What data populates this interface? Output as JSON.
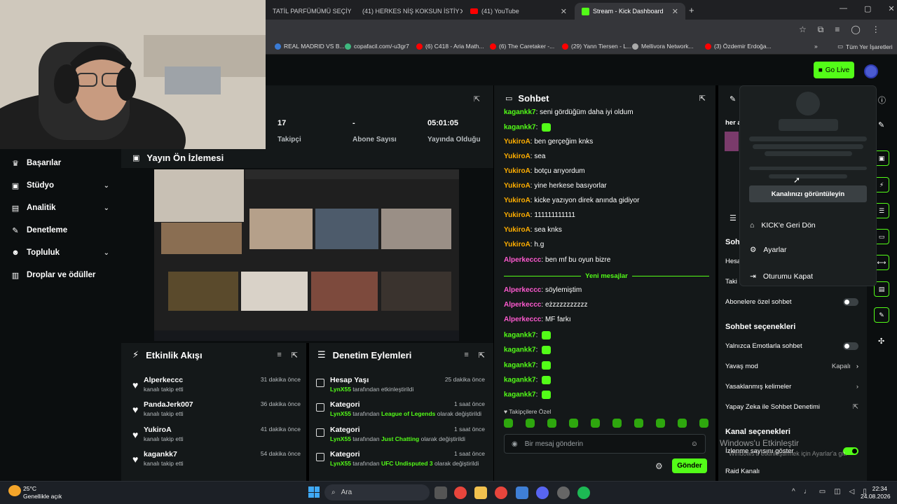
{
  "browser": {
    "tabs": [
      {
        "label": "TATİL PARFÜMÜMÜ SEÇİYO",
        "icon": "youtube-icon"
      },
      {
        "label": "(41) HERKES NİŞ KOKSUN İSTİY",
        "icon": "youtube-icon"
      },
      {
        "label": "(41) YouTube",
        "icon": "youtube-icon"
      },
      {
        "label": "Stream - Kick Dashboard",
        "icon": "kick-icon"
      }
    ],
    "bookmarks": [
      "REAL MADRID VS B...",
      "copafacil.com/-u3gr7",
      "(6) C418 - Aria Math...",
      "(6) The Caretaker -...",
      "(29) Yann Tiersen - L...",
      "Mellivora Network...",
      "(3) Özdemir Erdoğa..."
    ],
    "bookmarks_all": "Tüm Yer İşaretleri"
  },
  "header": {
    "go_live": "Go Live"
  },
  "sidebar": {
    "items": [
      {
        "label": "Başarılar",
        "icon": "trophy-icon",
        "chevron": false
      },
      {
        "label": "Stüdyo",
        "icon": "studio-icon",
        "chevron": true
      },
      {
        "label": "Analitik",
        "icon": "analytics-icon",
        "chevron": true
      },
      {
        "label": "Denetleme",
        "icon": "wrench-icon",
        "chevron": false
      },
      {
        "label": "Topluluk",
        "icon": "community-icon",
        "chevron": true
      },
      {
        "label": "Droplar ve ödüller",
        "icon": "drops-icon",
        "chevron": false
      }
    ]
  },
  "stats": {
    "followers": {
      "value": "17",
      "label": "Takipçi"
    },
    "subs": {
      "value": "-",
      "label": "Abone Sayısı"
    },
    "uptime": {
      "value": "05:01:05",
      "label": "Yayında Olduğu"
    }
  },
  "preview": {
    "title": "Yayın Ön İzlemesi"
  },
  "events": {
    "title": "Etkinlik Akışı",
    "rows": [
      {
        "name": "Alperkeccc",
        "sub": "kanalı takip etti",
        "time": "31 dakika önce"
      },
      {
        "name": "PandaJerk007",
        "sub": "kanalı takip etti",
        "time": "36 dakika önce"
      },
      {
        "name": "YukiroA",
        "sub": "kanalı takip etti",
        "time": "41 dakika önce"
      },
      {
        "name": "kagankk7",
        "sub": "kanalı takip etti",
        "time": "54 dakika önce"
      }
    ]
  },
  "moderation": {
    "title": "Denetim Eylemleri",
    "rows": [
      {
        "name": "Hesap Yaşı",
        "user": "LynX55",
        "pre": " tarafından etkinleştirildi",
        "target": "",
        "post": "",
        "time": "25 dakika önce"
      },
      {
        "name": "Kategori",
        "user": "LynX55",
        "pre": " tarafından ",
        "target": "League of Legends",
        "post": " olarak değiştirildi",
        "time": "1 saat önce"
      },
      {
        "name": "Kategori",
        "user": "LynX55",
        "pre": " tarafından ",
        "target": "Just Chatting",
        "post": " olarak değiştirildi",
        "time": "1 saat önce"
      },
      {
        "name": "Kategori",
        "user": "LynX55",
        "pre": " tarafından ",
        "target": "UFC Undisputed 3",
        "post": " olarak değiştirildi",
        "time": "1 saat önce"
      }
    ]
  },
  "chat": {
    "title": "Sohbet",
    "messages": [
      {
        "user": "kagankk7",
        "color": "c2",
        "text": "seni gördüğüm daha iyi oldum",
        "emotes": 0
      },
      {
        "user": "kagankk7",
        "color": "c2",
        "text": "",
        "emotes": 1
      },
      {
        "user": "YukiroA",
        "color": "c1",
        "text": "ben gerçeğim knks",
        "emotes": 0
      },
      {
        "user": "YukiroA",
        "color": "c1",
        "text": "sea",
        "emotes": 0
      },
      {
        "user": "YukiroA",
        "color": "c1",
        "text": "botçu arıyordum",
        "emotes": 0
      },
      {
        "user": "YukiroA",
        "color": "c1",
        "text": "yine herkese basıyorlar",
        "emotes": 0
      },
      {
        "user": "YukiroA",
        "color": "c1",
        "text": "kicke yazıyon direk anında gidiyor",
        "emotes": 0
      },
      {
        "user": "YukiroA",
        "color": "c1",
        "text": "111111111111",
        "emotes": 0
      },
      {
        "user": "YukiroA",
        "color": "c1",
        "text": "sea knks",
        "emotes": 0
      },
      {
        "user": "YukiroA",
        "color": "c1",
        "text": "h.g",
        "emotes": 0
      },
      {
        "user": "Alperkeccc",
        "color": "c3",
        "text": "ben mf bu oyun bizre",
        "emotes": 0
      }
    ],
    "new_messages": "Yeni mesajlar",
    "messages_after": [
      {
        "user": "Alperkeccc",
        "color": "c3",
        "text": "söylemiştim",
        "emotes": 0
      },
      {
        "user": "Alperkeccc",
        "color": "c3",
        "text": "eżzzzzzzzzzz",
        "emotes": 0
      },
      {
        "user": "Alperkeccc",
        "color": "c3",
        "text": "MF farkı",
        "emotes": 0
      },
      {
        "user": "kagankk7",
        "color": "c2",
        "text": "",
        "emotes": 1
      },
      {
        "user": "kagankk7",
        "color": "c2",
        "text": "",
        "emotes": 1
      },
      {
        "user": "kagankk7",
        "color": "c2",
        "text": "",
        "emotes": 1
      },
      {
        "user": "kagankk7",
        "color": "c2",
        "text": "",
        "emotes": 1
      },
      {
        "user": "kagankk7",
        "color": "c2",
        "text": "",
        "emotes": 1
      }
    ],
    "subs_only": "Takipçilere Özel",
    "input_placeholder": "Bir mesaj gönderin",
    "send": "Gönder"
  },
  "settings": {
    "partial_top": "her a",
    "partial_labels": [
      "Soh",
      "Hesa",
      "Taki"
    ],
    "sub_only_chat": "Abonelere özel sohbet",
    "chat_options": "Sohbet seçenekleri",
    "emotes_only": "Yalnızca Emotlarla sohbet",
    "slow_mode": "Yavaş mod",
    "slow_mode_value": "Kapalı",
    "banned_words": "Yasaklanmış kelimeler",
    "ai_mod": "Yapay Zeka ile Sohbet Denetimi",
    "channel_options": "Kanal seçenekleri",
    "view_count": "İzlenme sayısını göster",
    "raid": "Raid Kanalı"
  },
  "dropdown": {
    "view_channel": "Kanalınızı görüntüleyin",
    "back": "KICK'e Geri Dön",
    "settings": "Ayarlar",
    "logout": "Oturumu Kapat"
  },
  "watermark": {
    "line1": "Windows'u Etkinleştir",
    "line2": "Windows'u etkinleştirmek için Ayarlar'a git."
  },
  "taskbar": {
    "weather_temp": "25°C",
    "weather_desc": "Genellikle açık",
    "search": "Ara",
    "time": "22:34",
    "date": "24.08.2026"
  }
}
